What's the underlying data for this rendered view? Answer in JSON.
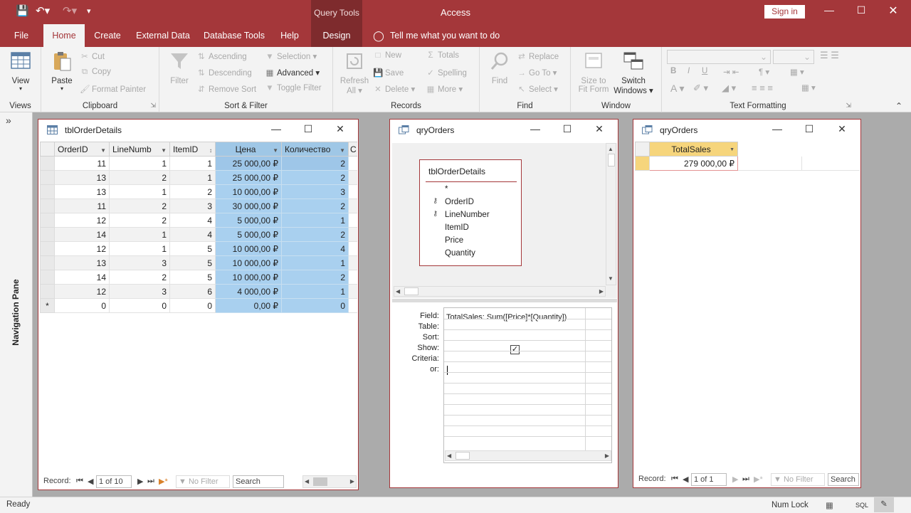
{
  "titlebar": {
    "context_tab_label": "Query Tools",
    "app_title": "Access",
    "sign_in": "Sign in"
  },
  "tabs": [
    "File",
    "Home",
    "Create",
    "External Data",
    "Database Tools",
    "Help",
    "Design"
  ],
  "tell_me": "Tell me what you want to do",
  "ribbon": {
    "views": {
      "label": "Views",
      "view": "View"
    },
    "clipboard": {
      "label": "Clipboard",
      "paste": "Paste",
      "cut": "Cut",
      "copy": "Copy",
      "format_painter": "Format Painter"
    },
    "sort_filter": {
      "label": "Sort & Filter",
      "filter": "Filter",
      "ascending": "Ascending",
      "descending": "Descending",
      "remove_sort": "Remove Sort",
      "selection": "Selection",
      "advanced": "Advanced",
      "toggle_filter": "Toggle Filter"
    },
    "records": {
      "label": "Records",
      "refresh": "Refresh",
      "all": "All",
      "new": "New",
      "save": "Save",
      "delete": "Delete",
      "totals": "Totals",
      "spelling": "Spelling",
      "more": "More"
    },
    "find": {
      "label": "Find",
      "find": "Find",
      "replace": "Replace",
      "goto": "Go To",
      "select": "Select"
    },
    "window": {
      "label": "Window",
      "size_to": "Size to",
      "fit_form": "Fit Form",
      "switch": "Switch",
      "windows": "Windows"
    },
    "text_formatting": {
      "label": "Text Formatting"
    }
  },
  "nav_pane": {
    "label": "Navigation Pane"
  },
  "table_window": {
    "title": "tblOrderDetails",
    "columns": [
      "OrderID",
      "LineNumb",
      "ItemID",
      "Цена",
      "Количество",
      "С"
    ],
    "rows": [
      [
        "11",
        "1",
        "1",
        "25 000,00 ₽",
        "2"
      ],
      [
        "13",
        "2",
        "1",
        "25 000,00 ₽",
        "2"
      ],
      [
        "13",
        "1",
        "2",
        "10 000,00 ₽",
        "3"
      ],
      [
        "11",
        "2",
        "3",
        "30 000,00 ₽",
        "2"
      ],
      [
        "12",
        "2",
        "4",
        "5 000,00 ₽",
        "1"
      ],
      [
        "14",
        "1",
        "4",
        "5 000,00 ₽",
        "2"
      ],
      [
        "12",
        "1",
        "5",
        "10 000,00 ₽",
        "4"
      ],
      [
        "13",
        "3",
        "5",
        "10 000,00 ₽",
        "1"
      ],
      [
        "14",
        "2",
        "5",
        "10 000,00 ₽",
        "2"
      ],
      [
        "12",
        "3",
        "6",
        "4 000,00 ₽",
        "1"
      ],
      [
        "0",
        "0",
        "0",
        "0,00 ₽",
        "0"
      ]
    ],
    "new_row_marker": "*",
    "record_label": "Record:",
    "record_pos": "1 of 10",
    "no_filter": "No Filter",
    "search": "Search"
  },
  "query_design_window": {
    "title": "qryOrders",
    "field_list": {
      "title": "tblOrderDetails",
      "fields": [
        "*",
        "OrderID",
        "LineNumber",
        "ItemID",
        "Price",
        "Quantity"
      ]
    },
    "grid_labels": [
      "Field:",
      "Table:",
      "Sort:",
      "Show:",
      "Criteria:",
      "or:"
    ],
    "field_expression": "TotalSales: Sum([Price]*[Quantity])",
    "show_checked": true
  },
  "query_result_window": {
    "title": "qryOrders",
    "column": "TotalSales",
    "value": "279 000,00 ₽",
    "record_label": "Record:",
    "record_pos": "1 of 1",
    "no_filter": "No Filter",
    "search": "Search"
  },
  "statusbar": {
    "left": "Ready",
    "num_lock": "Num Lock",
    "sql": "SQL"
  },
  "colors": {
    "accent": "#a4373a",
    "selection": "#a9d0ef",
    "ribbon": "#f3f3f3"
  }
}
